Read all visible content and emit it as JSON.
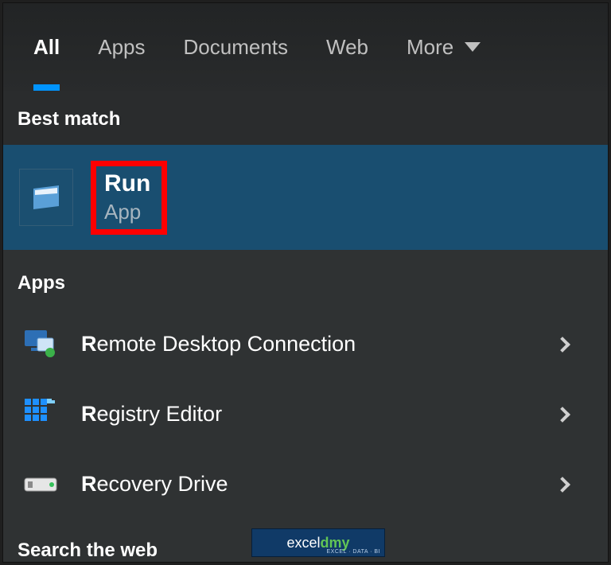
{
  "tabs": {
    "all": "All",
    "apps": "Apps",
    "documents": "Documents",
    "web": "Web",
    "more": "More"
  },
  "sections": {
    "best_match": "Best match",
    "apps": "Apps",
    "search_web": "Search the web"
  },
  "best_match_item": {
    "title_first": "R",
    "title_rest": "un",
    "subtitle": "App"
  },
  "app_items": [
    {
      "first": "R",
      "rest": "emote Desktop Connection"
    },
    {
      "first": "R",
      "rest": "egistry Editor"
    },
    {
      "first": "R",
      "rest": "ecovery Drive"
    }
  ],
  "watermark": {
    "brand_a": "excel",
    "brand_b": "dmy",
    "sub": "EXCEL · DATA · BI"
  }
}
